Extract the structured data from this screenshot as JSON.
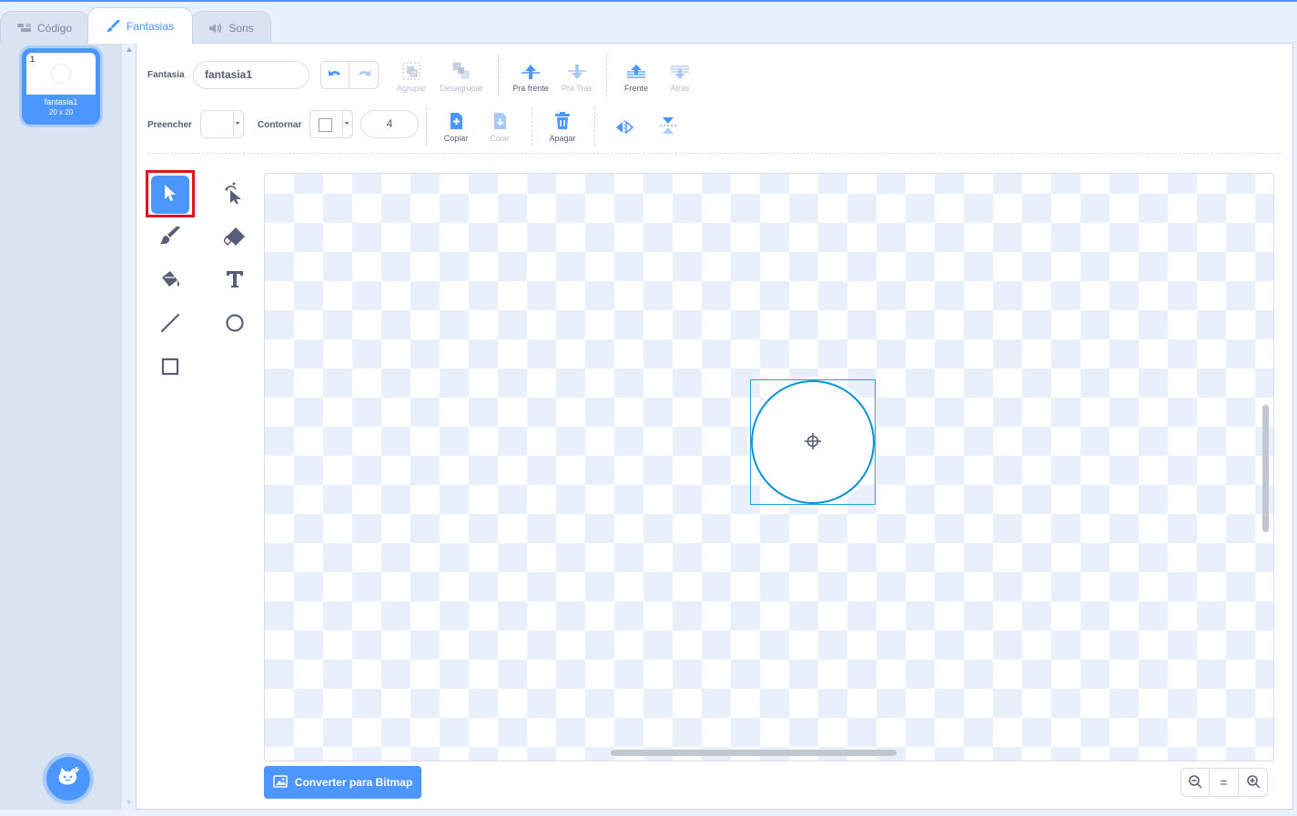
{
  "tabs": {
    "code_label": "Código",
    "costumes_label": "Fantasias",
    "sounds_label": "Sons"
  },
  "costume_list": {
    "items": [
      {
        "number": "1",
        "name": "fantasia1",
        "size": "20 x 20"
      }
    ]
  },
  "toolbar": {
    "costume_label": "Fantasia",
    "costume_name": "fantasia1",
    "group_label": "Agrupar",
    "ungroup_label": "Desagrupar",
    "forward_label": "Pra frente",
    "backward_label": "Pra Trás",
    "front_label": "Frente",
    "back_label": "Atrás",
    "fill_label": "Preencher",
    "outline_label": "Contornar",
    "stroke_width": "4",
    "copy_label": "Copiar",
    "paste_label": "Colar",
    "delete_label": "Apagar"
  },
  "tools": {
    "selected": "select",
    "items": [
      "select",
      "reshape",
      "brush",
      "eraser",
      "fill",
      "text",
      "line",
      "circle",
      "rectangle"
    ]
  },
  "canvas": {
    "shape": "circle",
    "shape_stroke_color": "#0d92d6",
    "selection_color": "#29a1e0"
  },
  "footer": {
    "convert_label": "Converter para Bitmap",
    "zoom_out": "zoom-out",
    "zoom_reset": "=",
    "zoom_in": "zoom-in"
  },
  "colors": {
    "accent": "#4c97ff",
    "highlight": "#e3101e",
    "text": "#575e75"
  }
}
